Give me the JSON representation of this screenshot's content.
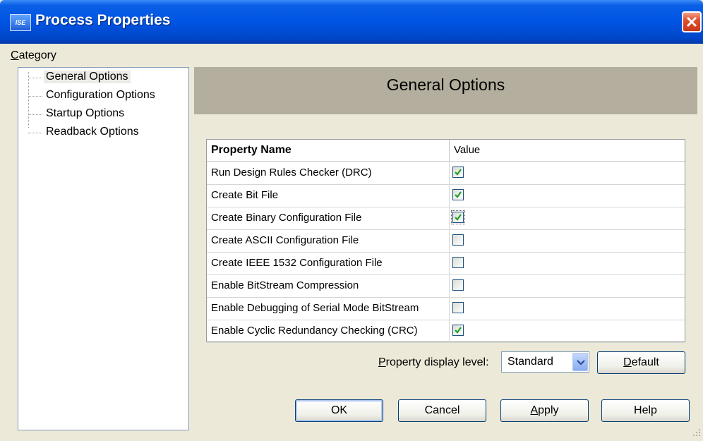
{
  "window": {
    "title": "Process Properties",
    "icon": "ise-app-icon"
  },
  "sidebar": {
    "label": "Category",
    "items": [
      {
        "label": "General Options",
        "selected": true
      },
      {
        "label": "Configuration Options",
        "selected": false
      },
      {
        "label": "Startup Options",
        "selected": false
      },
      {
        "label": "Readback Options",
        "selected": false
      }
    ]
  },
  "main": {
    "header": "General Options",
    "table": {
      "columns": [
        "Property Name",
        "Value"
      ],
      "rows": [
        {
          "name": "Run Design Rules Checker (DRC)",
          "checked": true
        },
        {
          "name": "Create Bit File",
          "checked": true
        },
        {
          "name": "Create Binary Configuration File",
          "checked": true,
          "focused": true
        },
        {
          "name": "Create ASCII Configuration File",
          "checked": false
        },
        {
          "name": "Create IEEE 1532 Configuration File",
          "checked": false
        },
        {
          "name": "Enable BitStream Compression",
          "checked": false
        },
        {
          "name": "Enable Debugging of Serial Mode BitStream",
          "checked": false
        },
        {
          "name": "Enable Cyclic Redundancy Checking (CRC)",
          "checked": true
        }
      ]
    },
    "display_level": {
      "label": "Property display level:",
      "value": "Standard"
    },
    "default_button": "Default"
  },
  "footer": {
    "ok": "OK",
    "cancel": "Cancel",
    "apply": "Apply",
    "help": "Help"
  },
  "colors": {
    "titlebar": "#0054e3",
    "header_band": "#b3ae9d",
    "dialog_bg": "#ece9d8",
    "check": "#21a121"
  }
}
